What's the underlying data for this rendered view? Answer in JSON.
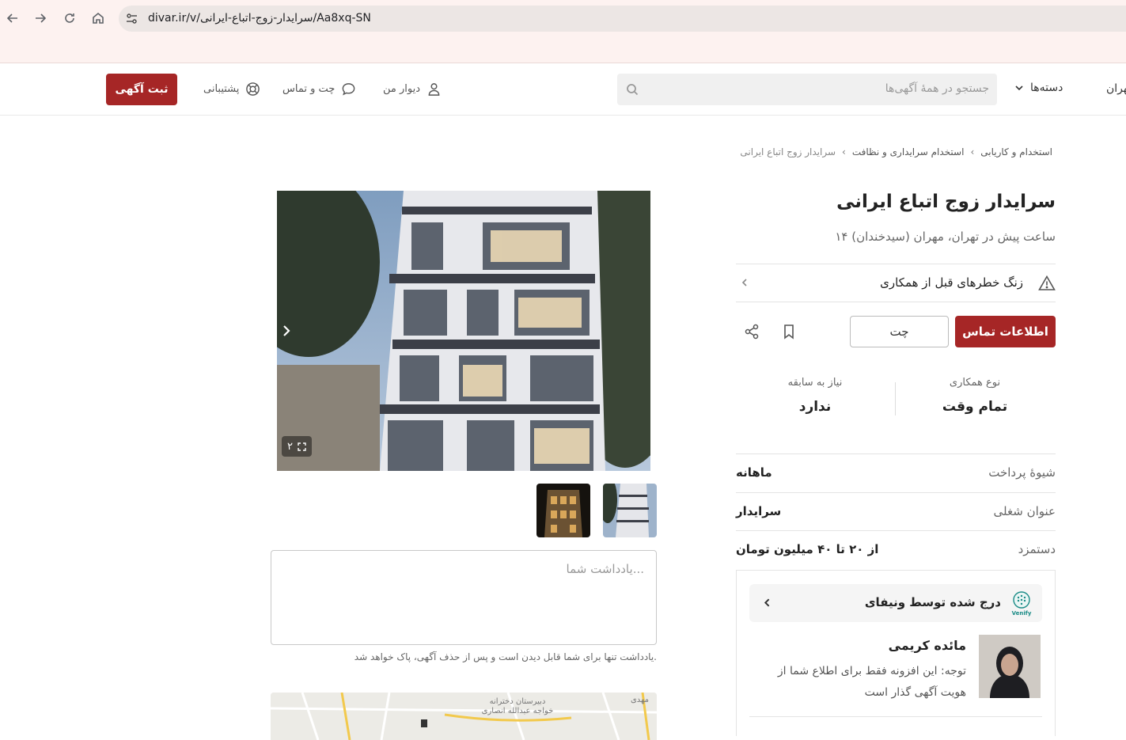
{
  "browser": {
    "url": "divar.ir/v/سرایدار-زوج-اتباع-ایرانی/Aa8xq-SN"
  },
  "header": {
    "post_button": "ثبت آگهی",
    "support": "پشتیبانی",
    "chat": "چت و تماس",
    "my_divar": "دیوار من",
    "search_placeholder": "جستجو در همهٔ آگهی‌ها",
    "categories": "دسته‌ها",
    "city": "تهران"
  },
  "breadcrumb": [
    "استخدام و کاریابی",
    "استخدام سرایداری و نظافت",
    "سرایدار زوج اتباع ایرانی"
  ],
  "ad": {
    "title": "سرایدار زوج اتباع ایرانی",
    "meta": "۱۴ ساعت پیش در تهران، مهران (سیدخندان)",
    "alert": "زنگ خطرهای قبل از همکاری",
    "contact_button": "اطلاعات تماس",
    "chat_button": "چت",
    "image_count": "۲",
    "info": [
      {
        "key": "نوع همکاری",
        "value": "تمام وقت"
      },
      {
        "key": "نیاز به سابقه",
        "value": "ندارد"
      }
    ],
    "details": [
      {
        "key": "شیوهٔ پرداخت",
        "value": "ماهانه"
      },
      {
        "key": "عنوان شغلی",
        "value": "سرایدار"
      },
      {
        "key": "دستمزد",
        "value": "از ۲۰ تا ۴۰ میلیون تومان"
      }
    ],
    "verify": {
      "label": "درج شده توسط ونیفای",
      "logo_text": "Venify",
      "agent_name": "مائده کریمی",
      "agent_note": "توجه: این افزونه فقط برای اطلاع شما از هویت آگهی گذار است"
    },
    "note_placeholder": "یادداشت شما...",
    "note_help": "یادداشت تنها برای شما قابل دیدن است و پس از حذف آگهی، پاک خواهد شد.",
    "map_labels": [
      "دبیرستان دخترانه",
      "خواجه عبدالله انصاری",
      "مهدی"
    ]
  }
}
